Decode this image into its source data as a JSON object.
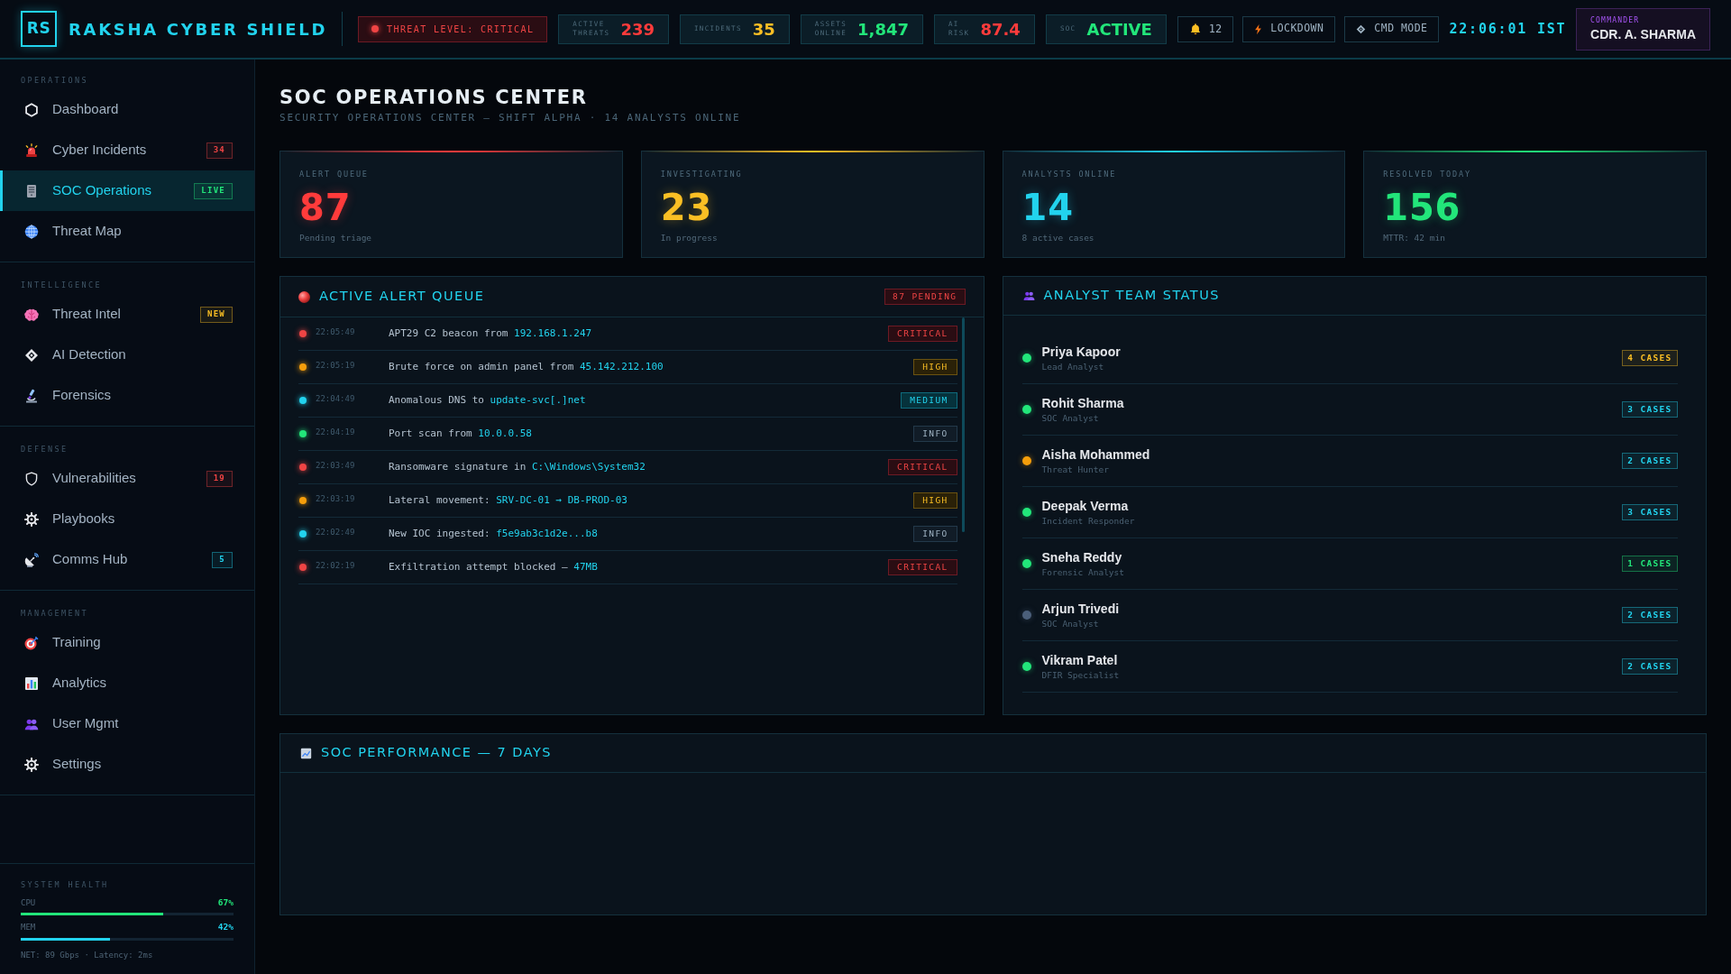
{
  "header": {
    "logo": "RS",
    "title": "RAKSHA CYBER SHIELD",
    "threat_level": "THREAT LEVEL: CRITICAL",
    "metrics": [
      {
        "label": "ACTIVE THREATS",
        "value": "239",
        "color": "#ff3b3b"
      },
      {
        "label": "INCIDENTS",
        "value": "35",
        "color": "#fbbf24"
      },
      {
        "label": "ASSETS ONLINE",
        "value": "1,847",
        "color": "#22e67a"
      },
      {
        "label": "AI RISK",
        "value": "87.4",
        "color": "#ff3b3b"
      },
      {
        "label": "SOC",
        "value": "ACTIVE",
        "color": "#22e67a"
      }
    ],
    "notifications": "12",
    "buttons": [
      "LOCKDOWN",
      "CMD MODE"
    ],
    "clock": "22:06:01 IST",
    "user": {
      "role": "COMMANDER",
      "name": "CDR. A. SHARMA"
    }
  },
  "sidebar": {
    "sections": [
      {
        "title": "OPERATIONS",
        "items": [
          {
            "label": "Dashboard",
            "selected": false
          },
          {
            "label": "Cyber Incidents",
            "badge": "34",
            "color": "#ef4444",
            "selected": false
          },
          {
            "label": "SOC Operations",
            "badge": "LIVE",
            "color": "#22e67a",
            "selected": true
          },
          {
            "label": "Threat Map",
            "selected": false
          }
        ]
      },
      {
        "title": "INTELLIGENCE",
        "items": [
          {
            "label": "Threat Intel",
            "badge": "NEW",
            "color": "#fbbf24",
            "selected": false
          },
          {
            "label": "AI Detection",
            "selected": false
          },
          {
            "label": "Forensics",
            "selected": false
          }
        ]
      },
      {
        "title": "DEFENSE",
        "items": [
          {
            "label": "Vulnerabilities",
            "badge": "19",
            "color": "#ef4444",
            "selected": false
          },
          {
            "label": "Playbooks",
            "selected": false
          },
          {
            "label": "Comms Hub",
            "badge": "5",
            "color": "#22d3ee",
            "selected": false
          }
        ]
      },
      {
        "title": "MANAGEMENT",
        "items": [
          {
            "label": "Training",
            "selected": false
          },
          {
            "label": "Analytics",
            "selected": false
          },
          {
            "label": "User Mgmt",
            "selected": false
          },
          {
            "label": "Settings",
            "selected": false
          }
        ]
      }
    ],
    "system_health": {
      "title": "SYSTEM HEALTH",
      "meters": [
        {
          "label": "CPU",
          "reading": "67%",
          "level": 0.67,
          "color": "#22e67a"
        },
        {
          "label": "MEM",
          "reading": "42%",
          "level": 0.42,
          "color": "#22d3ee"
        }
      ],
      "footer": "NET: 89 Gbps · Latency: 2ms"
    }
  },
  "page": {
    "title": "SOC OPERATIONS CENTER",
    "subtitle": "SECURITY OPERATIONS CENTER — SHIFT ALPHA · 14 ANALYSTS ONLINE"
  },
  "stats": [
    {
      "label": "ALERT QUEUE",
      "value": "87",
      "note": "Pending triage",
      "color": "#ff3b3b"
    },
    {
      "label": "INVESTIGATING",
      "value": "23",
      "note": "In progress",
      "color": "#fbbf24"
    },
    {
      "label": "ANALYSTS ONLINE",
      "value": "14",
      "note": "8 active cases",
      "color": "#22d3ee"
    },
    {
      "label": "RESOLVED TODAY",
      "value": "156",
      "note": "MTTR: 42 min",
      "color": "#22e67a"
    }
  ],
  "alert_queue": {
    "title": "ACTIVE ALERT QUEUE",
    "badge": "87 PENDING",
    "alerts": [
      {
        "time": "22:05:49",
        "message": "APT29 C2 beacon from",
        "target": "192.168.1.247",
        "severity": {
          "text": "CRITICAL",
          "kind": "critical"
        },
        "color": "#ef4444"
      },
      {
        "time": "22:05:19",
        "message": "Brute force on admin panel from",
        "target": "45.142.212.100",
        "severity": {
          "text": "HIGH",
          "kind": "high"
        },
        "color": "#f59e0b"
      },
      {
        "time": "22:04:49",
        "message": "Anomalous DNS to",
        "target": "update-svc[.]net",
        "severity": {
          "text": "MEDIUM",
          "kind": "medium"
        },
        "color": "#22d3ee"
      },
      {
        "time": "22:04:19",
        "message": "Port scan from",
        "target": "10.0.0.58",
        "severity": {
          "text": "INFO",
          "kind": "info"
        },
        "color": "#22e67a"
      },
      {
        "time": "22:03:49",
        "message": "Ransomware signature in",
        "target": "C:\\Windows\\System32",
        "severity": {
          "text": "CRITICAL",
          "kind": "critical"
        },
        "color": "#ef4444"
      },
      {
        "time": "22:03:19",
        "message": "Lateral movement:",
        "target": "SRV-DC-01 → DB-PROD-03",
        "severity": {
          "text": "HIGH",
          "kind": "high"
        },
        "color": "#f59e0b"
      },
      {
        "time": "22:02:49",
        "message": "New IOC ingested:",
        "target": "f5e9ab3c1d2e...b8",
        "severity": {
          "text": "INFO",
          "kind": "info"
        },
        "color": "#22d3ee"
      },
      {
        "time": "22:02:19",
        "message": "Exfiltration attempt blocked —",
        "target": "47MB",
        "severity": {
          "text": "CRITICAL",
          "kind": "critical"
        },
        "color": "#ef4444"
      }
    ]
  },
  "analyst_team": {
    "title": "ANALYST TEAM STATUS",
    "analysts": [
      {
        "name": "Priya Kapoor",
        "role": "Lead Analyst",
        "color": "#22e67a",
        "cases": {
          "text": "4 CASES",
          "color": "#fbbf24"
        }
      },
      {
        "name": "Rohit Sharma",
        "role": "SOC Analyst",
        "color": "#22e67a",
        "cases": {
          "text": "3 CASES",
          "color": "#22d3ee"
        }
      },
      {
        "name": "Aisha Mohammed",
        "role": "Threat Hunter",
        "color": "#f59e0b",
        "cases": {
          "text": "2 CASES",
          "color": "#22d3ee"
        }
      },
      {
        "name": "Deepak Verma",
        "role": "Incident Responder",
        "color": "#22e67a",
        "cases": {
          "text": "3 CASES",
          "color": "#22d3ee"
        }
      },
      {
        "name": "Sneha Reddy",
        "role": "Forensic Analyst",
        "color": "#22e67a",
        "cases": {
          "text": "1 CASES",
          "color": "#22e67a"
        }
      },
      {
        "name": "Arjun Trivedi",
        "role": "SOC Analyst",
        "color": "#4b5f7a",
        "cases": {
          "text": "2 CASES",
          "color": "#22d3ee"
        }
      },
      {
        "name": "Vikram Patel",
        "role": "DFIR Specialist",
        "color": "#22e67a",
        "cases": {
          "text": "2 CASES",
          "color": "#22d3ee"
        }
      }
    ]
  },
  "performance": {
    "title": "SOC PERFORMANCE — 7 DAYS"
  }
}
